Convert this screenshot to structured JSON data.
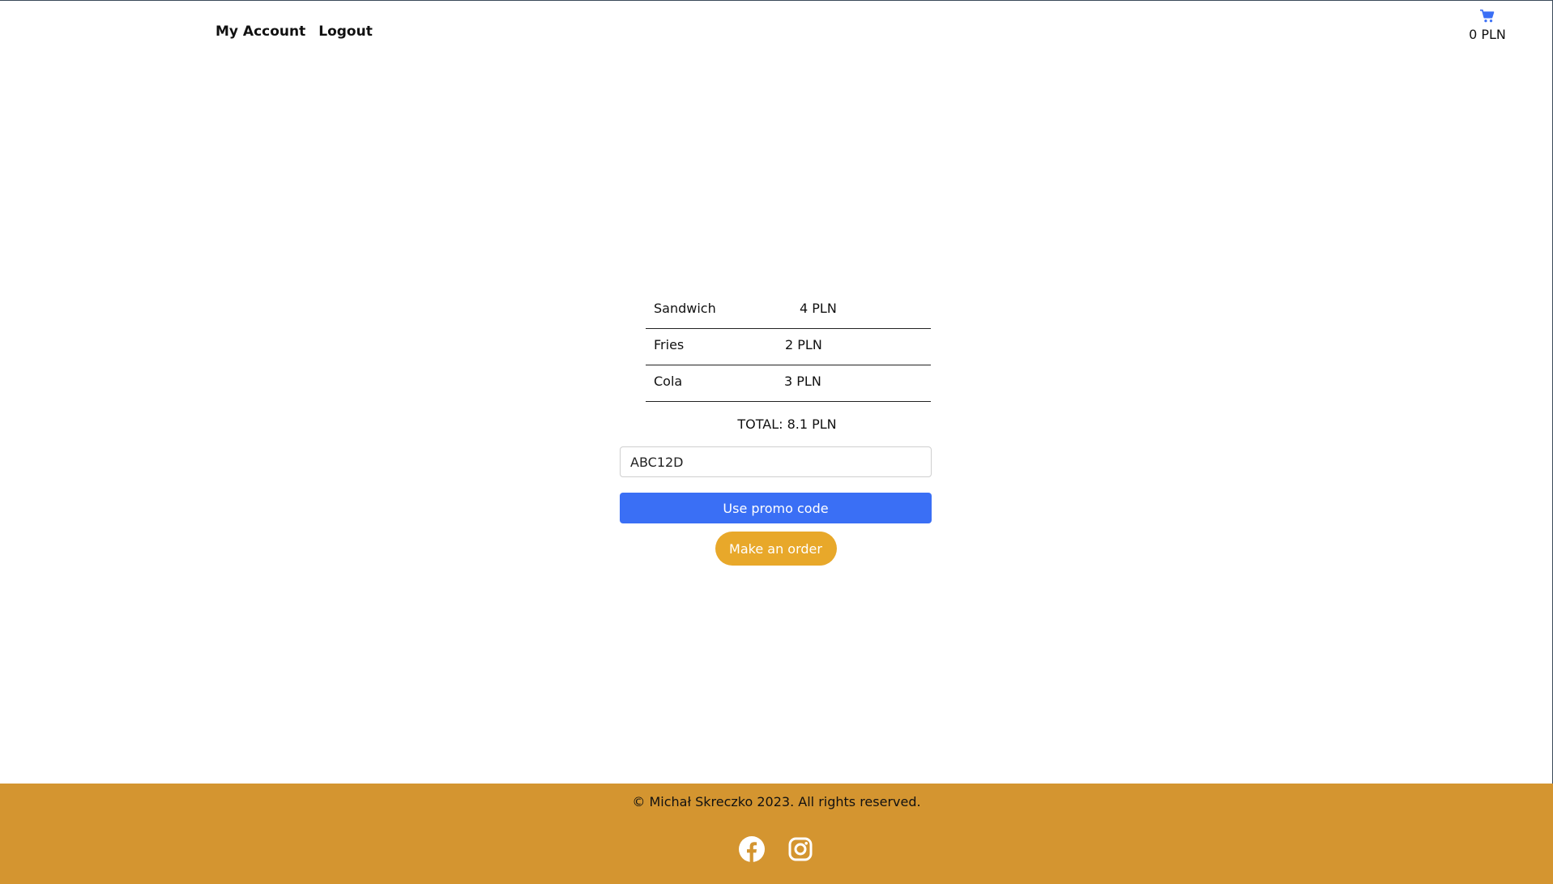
{
  "header": {
    "nav": [
      {
        "label": "My Account"
      },
      {
        "label": "Logout"
      }
    ],
    "cart": {
      "icon": "shopping-cart-icon",
      "total": "0 PLN",
      "icon_color": "#3a6ff5"
    }
  },
  "cart_items": [
    {
      "name": "Sandwich",
      "price": "4 PLN"
    },
    {
      "name": "Fries",
      "price": "2 PLN"
    },
    {
      "name": "Cola",
      "price": "3 PLN"
    }
  ],
  "total": "TOTAL: 8.1 PLN",
  "promo": {
    "value": "ABC12D",
    "button_label": "Use promo code",
    "button_color": "#3a6ff5"
  },
  "order_button": {
    "label": "Make an order",
    "color": "#e8a82a"
  },
  "footer": {
    "copyright": "© Michał Skreczko 2023. All rights reserved.",
    "background": "#d49530",
    "social": [
      {
        "icon": "facebook-icon"
      },
      {
        "icon": "instagram-icon"
      }
    ]
  }
}
